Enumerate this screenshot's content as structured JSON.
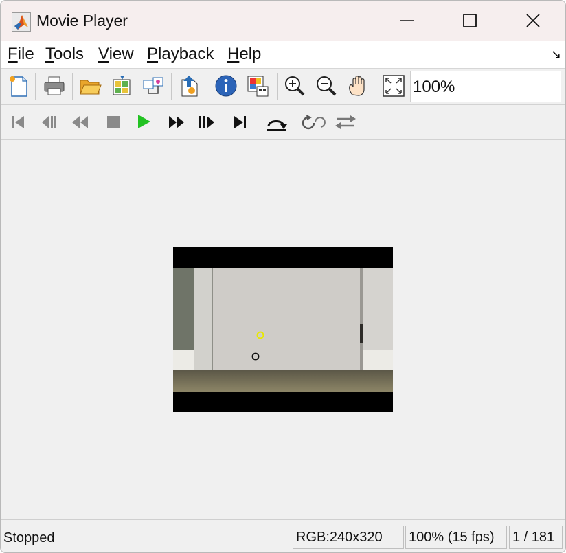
{
  "window": {
    "title": "Movie Player",
    "app_icon": "matlab-icon"
  },
  "menu": [
    "File",
    "Tools",
    "View",
    "Playback",
    "Help"
  ],
  "toolbar1": {
    "icons": [
      "new-icon",
      "print-icon",
      "open-icon",
      "export-icon",
      "connect-icon",
      "import-icon",
      "info-icon",
      "colormap-icon",
      "zoom-in-icon",
      "zoom-out-icon",
      "pan-icon",
      "fit-icon"
    ],
    "zoom_value": "100%"
  },
  "toolbar2": {
    "icons": [
      "go-to-first-icon",
      "step-back-icon",
      "rewind-icon",
      "stop-icon",
      "play-icon",
      "fast-forward-icon",
      "step-forward-icon",
      "go-to-last-icon",
      "jump-to-icon",
      "repeat-icon",
      "forward-backward-icon"
    ],
    "colors": {
      "play": "#22c222",
      "disabled": "#8a8a8a",
      "active": "#111111"
    }
  },
  "status": {
    "state": "Stopped",
    "color_format": "RGB:240x320",
    "zoom_fps": "100% (15 fps)",
    "frame": "1 / 181"
  }
}
